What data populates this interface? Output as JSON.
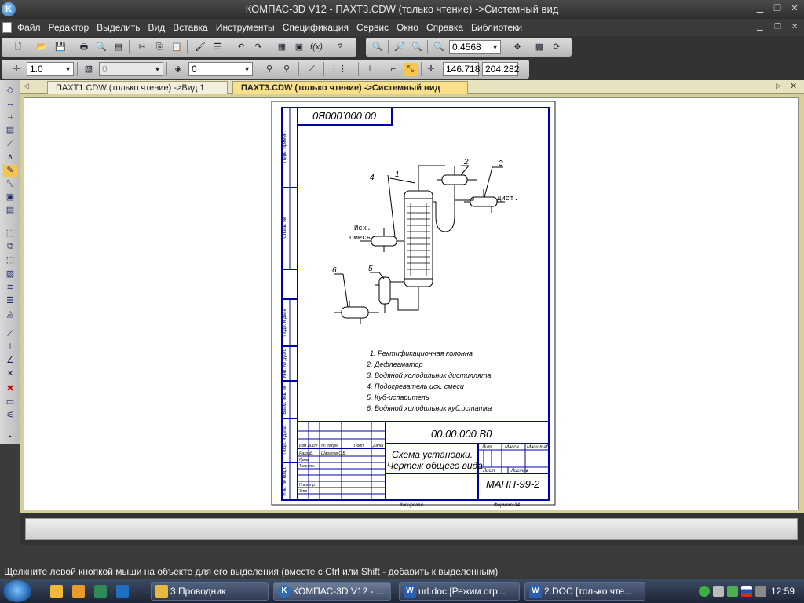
{
  "window": {
    "title": "КОМПАС-3D V12 - ПАХТ3.CDW (только чтение) ->Системный вид",
    "app_icon": "K"
  },
  "menu": {
    "items": [
      "Файл",
      "Редактор",
      "Выделить",
      "Вид",
      "Вставка",
      "Инструменты",
      "Спецификация",
      "Сервис",
      "Окно",
      "Справка",
      "Библиотеки"
    ]
  },
  "toolbar": {
    "zoom_value": "0.4568",
    "line_step": "1.0",
    "layer_value": "0",
    "style_value": "0",
    "coord_x": "146.718",
    "coord_y": "204.282"
  },
  "tabs": [
    {
      "label": "ПАХТ1.CDW (только чтение) ->Вид 1",
      "active": false
    },
    {
      "label": "ПАХТ3.CDW (только чтение) ->Системный вид",
      "active": true
    }
  ],
  "drawing": {
    "top_code": "00.000.000В0",
    "code": "00.00.000.В0",
    "title_line1": "Схема установки.",
    "title_line2": "Чертеж общего вида",
    "org_code": "МАПП-99-2",
    "copy_label": "Копировал",
    "format_label": "Формат   А4",
    "lit_label": "Лит.",
    "mass_label": "Масса",
    "scale_label": "Масштаб",
    "sheet_label": "Лист",
    "sheets_label": "Листов",
    "title_rows": [
      "Изм Лист",
      "№ докум.",
      "Подп.",
      "Дата"
    ],
    "roles": [
      "Разраб.",
      "Пров.",
      "Т.контр.",
      "Н.контр.",
      "Утв."
    ],
    "developer_name": "Шарапов С.Б.",
    "side_labels": [
      "Перв. примен.",
      "Справ. №",
      "Подп. и дата",
      "Инв. № дубл.",
      "Взам. инв. №",
      "Подп. и дата",
      "Инв. № подл."
    ],
    "callouts": [
      "1",
      "2",
      "3",
      "4",
      "5",
      "6"
    ],
    "inlet_line1": "Исх.",
    "inlet_line2": "смесь",
    "outlet_label": "Дист.",
    "legend": [
      "1. Ректификационная колонна",
      "2. Дефлегматор",
      "3. Водяной холодильник дистиллята",
      "4. Подогреватель исх. смеси",
      "5. Куб-испаритель",
      "6. Водяной холодильник куб.остатка"
    ]
  },
  "statusbar": {
    "text": "Щелкните левой кнопкой мыши на объекте для его выделения (вместе с Ctrl или Shift - добавить к выделенным)"
  },
  "taskbar": {
    "items": [
      {
        "label": "3 Проводник",
        "active": false
      },
      {
        "label": "КОМПАС-3D V12 - ...",
        "active": true
      },
      {
        "label": "url.doc [Режим огр...",
        "active": false
      },
      {
        "label": "2.DOC [только чте...",
        "active": false
      }
    ],
    "clock": "12:59"
  },
  "colors": {
    "drawing_lines": "#0000a8",
    "doc_bg": "#d7cf9a",
    "active_tab": "#fbe08a"
  }
}
